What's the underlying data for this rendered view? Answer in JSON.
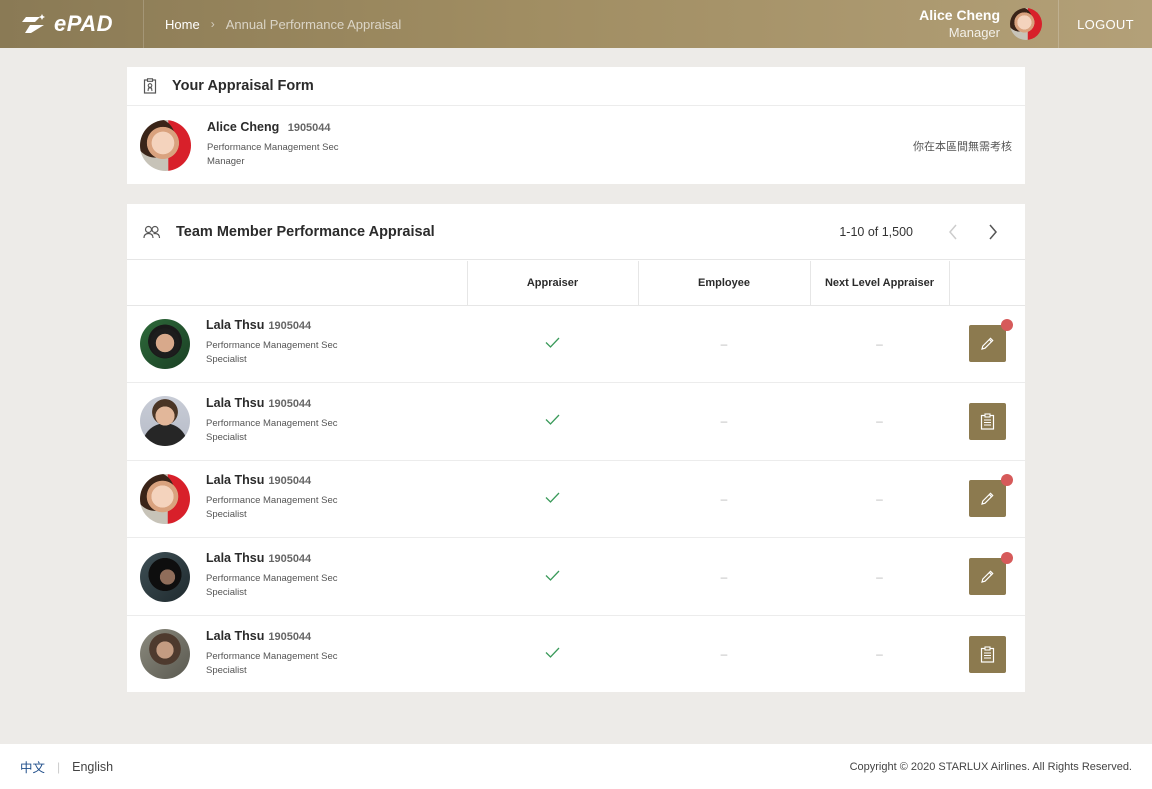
{
  "header": {
    "logo_text": "ePAD",
    "breadcrumb": [
      "Home",
      "Annual Performance Appraisal"
    ],
    "user": {
      "name": "Alice Cheng",
      "role": "Manager"
    },
    "logout_label": "LOGOUT"
  },
  "own_form": {
    "title": "Your Appraisal Form",
    "person": {
      "name": "Alice Cheng",
      "id": "1905044",
      "dept": "Performance Management Sec",
      "role": "Manager"
    },
    "note": "你在本區間無需考核"
  },
  "team": {
    "title": "Team Member Performance Appraisal",
    "pagination": "1-10 of 1,500",
    "columns": [
      "Appraiser",
      "Employee",
      "Next Level Appraiser"
    ],
    "rows": [
      {
        "name": "Lala Thsu",
        "id": "1905044",
        "dept": "Performance Management Sec",
        "role": "Specialist",
        "appraiser": "done",
        "employee": "–",
        "next_level": "–",
        "action": "edit",
        "notification": true
      },
      {
        "name": "Lala Thsu",
        "id": "1905044",
        "dept": "Performance Management Sec",
        "role": "Specialist",
        "appraiser": "done",
        "employee": "–",
        "next_level": "–",
        "action": "view",
        "notification": false
      },
      {
        "name": "Lala Thsu",
        "id": "1905044",
        "dept": "Performance Management Sec",
        "role": "Specialist",
        "appraiser": "done",
        "employee": "–",
        "next_level": "–",
        "action": "edit",
        "notification": true
      },
      {
        "name": "Lala Thsu",
        "id": "1905044",
        "dept": "Performance Management Sec",
        "role": "Specialist",
        "appraiser": "done",
        "employee": "–",
        "next_level": "–",
        "action": "edit",
        "notification": true
      },
      {
        "name": "Lala Thsu",
        "id": "1905044",
        "dept": "Performance Management Sec",
        "role": "Specialist",
        "appraiser": "done",
        "employee": "–",
        "next_level": "–",
        "action": "view",
        "notification": false
      }
    ]
  },
  "footer": {
    "lang_zh": "中文",
    "lang_en": "English",
    "copyright": "Copyright © 2020 STARLUX Airlines. All Rights Reserved."
  },
  "colors": {
    "header_gold": "#a08d62",
    "action_button": "#8c7a4f",
    "notification_dot": "#d65a5a",
    "check_green": "#3a9a5a",
    "link_blue": "#1f4e8a"
  },
  "icons": {
    "logo": "starlux-logo-icon",
    "form": "clipboard-badge-icon",
    "team": "users-icon",
    "check": "check-icon",
    "edit": "pencil-icon",
    "view": "clipboard-list-icon",
    "prev": "chevron-left-icon",
    "next": "chevron-right-icon"
  }
}
